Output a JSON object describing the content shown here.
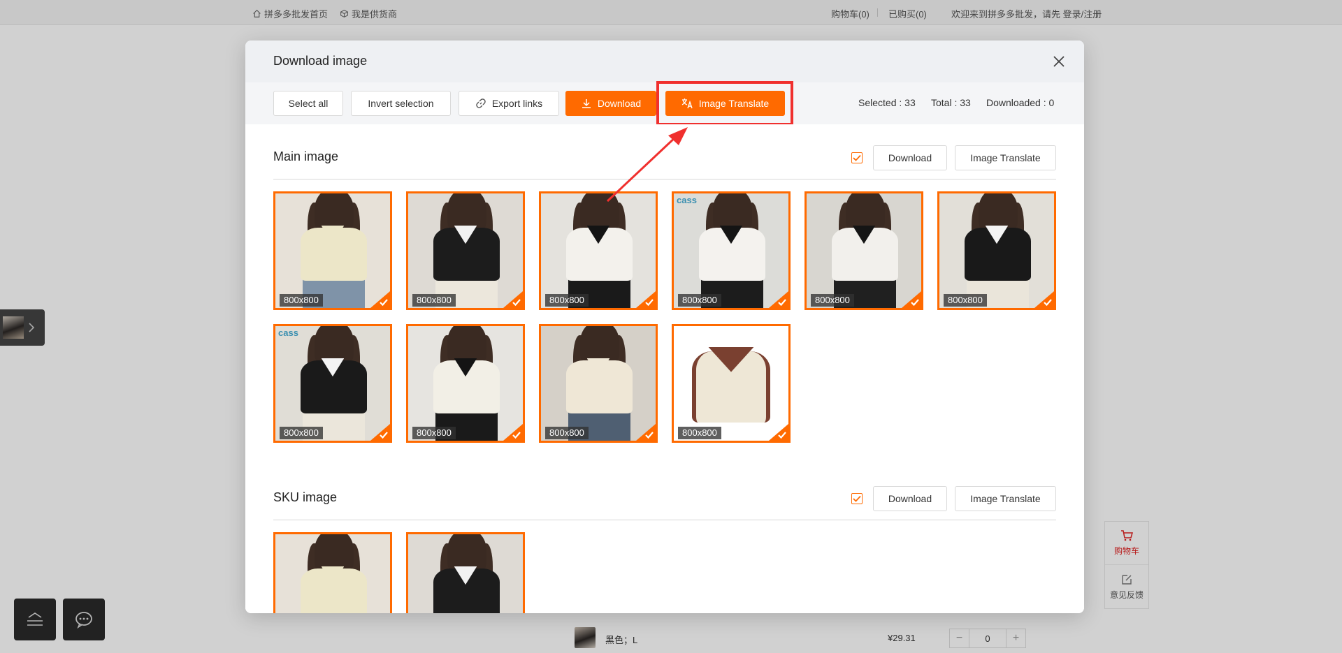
{
  "topbar": {
    "home_link": "拼多多批发首页",
    "supplier_link": "我是供货商",
    "cart_link": "购物车(0)",
    "purchased_link": "已购买(0)",
    "welcome_text": "欢迎来到拼多多批发，请先 登录/注册"
  },
  "background_row": {
    "sku": "黑色；L",
    "price": "¥29.31",
    "quantity": "0"
  },
  "side_panel": {
    "cart_label": "购物车",
    "feedback_label": "意见反馈"
  },
  "modal": {
    "title": "Download image",
    "toolbar": {
      "select_all": "Select all",
      "invert_selection": "Invert selection",
      "export_links": "Export links",
      "download": "Download",
      "image_translate": "Image Translate",
      "selected": "Selected : 33",
      "total": "Total : 33",
      "downloaded": "Downloaded : 0"
    },
    "main_section": {
      "title": "Main image",
      "download": "Download",
      "image_translate": "Image Translate",
      "images": [
        {
          "size": "800x800",
          "shirt": "#ece6c8",
          "collar": "#ece6c8",
          "bg": "#e7e1d8",
          "skirt": "#7f93a8"
        },
        {
          "size": "800x800",
          "shirt": "#1c1c1c",
          "collar": "#f2f2f2",
          "bg": "#dedad4",
          "skirt": "#ece7dc"
        },
        {
          "size": "800x800",
          "shirt": "#f3f1ec",
          "collar": "#141414",
          "bg": "#e4e2dd",
          "skirt": "#1a1a1a"
        },
        {
          "size": "800x800",
          "shirt": "#f4f2ee",
          "collar": "#141414",
          "bg": "#dcdcd8",
          "skirt": "#1c1c1c",
          "brand": "cass"
        },
        {
          "size": "800x800",
          "shirt": "#f2f0ec",
          "collar": "#151515",
          "bg": "#d8d6d0",
          "skirt": "#202020"
        },
        {
          "size": "800x800",
          "shirt": "#191919",
          "collar": "#f4f4f4",
          "bg": "#e2dfd8",
          "skirt": "#eae5da"
        },
        {
          "size": "800x800",
          "shirt": "#1a1a1a",
          "collar": "#f4f4f4",
          "bg": "#e0ddd6",
          "skirt": "#ebe6db",
          "brand": "cass"
        },
        {
          "size": "800x800",
          "shirt": "#f2efe6",
          "collar": "#141414",
          "bg": "#e6e4e0",
          "skirt": "#1a1a1a"
        },
        {
          "size": "800x800",
          "shirt": "#efe7d6",
          "collar": "#efe7d6",
          "bg": "#d5d0c8",
          "skirt": "#4f5f72"
        },
        {
          "size": "800x800",
          "shirt": "#eee7d6",
          "collar": "#7a4030",
          "bg": "#ffffff",
          "skirt": "#ffffff"
        }
      ]
    },
    "sku_section": {
      "title": "SKU image",
      "download": "Download",
      "image_translate": "Image Translate",
      "images": [
        {
          "shirt": "#ece6c8",
          "collar": "#ece6c8",
          "bg": "#e7e1d8",
          "skirt": "#7f93a8"
        },
        {
          "shirt": "#1c1c1c",
          "collar": "#f2f2f2",
          "bg": "#dedad4",
          "skirt": "#ece7dc"
        }
      ]
    }
  },
  "colors": {
    "accent": "#ff6a00",
    "highlight": "#f0302e"
  }
}
